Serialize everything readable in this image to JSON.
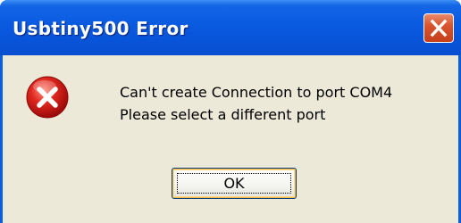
{
  "dialog": {
    "title": "Usbtiny500 Error",
    "icon": "error-icon",
    "message_line1": "Can't create Connection to port COM4",
    "message_line2": "Please select a different port",
    "ok_label": "OK",
    "close_icon": "close-icon"
  },
  "colors": {
    "titlebar": "#0a5ae0",
    "client_background": "#ece9d8",
    "close_button": "#d9552e",
    "error_icon": "#c81e1e",
    "button_border": "#003c74"
  }
}
